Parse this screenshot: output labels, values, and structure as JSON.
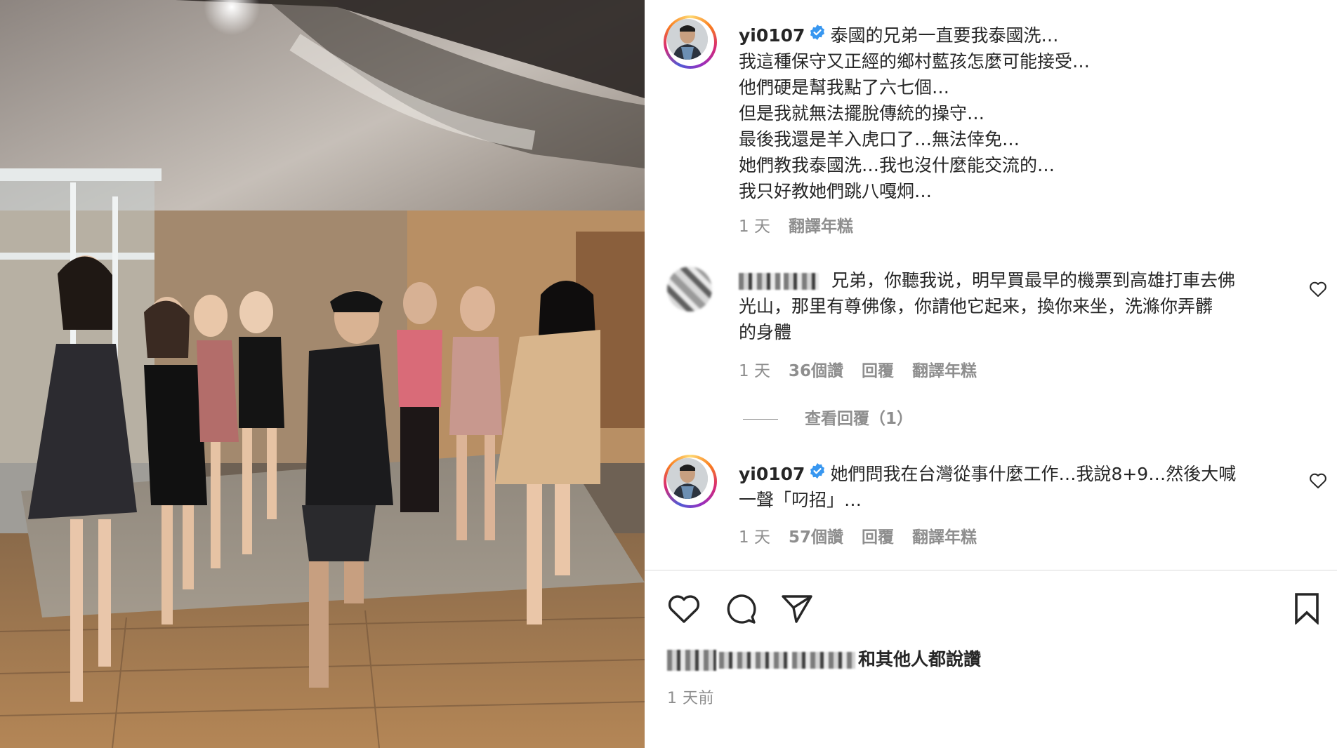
{
  "post": {
    "author": "yi0107",
    "caption_lines": [
      "泰國的兄弟一直要我泰國洗…",
      "我這種保守又正經的鄉村藍孩怎麼可能接受…",
      "他們硬是幫我點了六七個…",
      "但是我就無法擺脫傳統的操守…",
      "最後我還是羊入虎口了…無法倖免…",
      "她們教我泰國洗…我也沒什麼能交流的…",
      "我只好教她們跳八嘎炯…"
    ],
    "time": "1 天",
    "translate": "翻譯年糕"
  },
  "comments": [
    {
      "username": "",
      "text_lines": [
        "兄弟，你聽我说，明早買最早的機票到高雄打車去佛",
        "光山，那里有尊佛像，你請他它起来，換你来坐，洗滌你弄髒",
        "的身體"
      ],
      "time": "1 天",
      "likes": "36個讚",
      "reply": "回覆",
      "translate": "翻譯年糕",
      "view_replies": "查看回覆（1）"
    },
    {
      "username": "yi0107",
      "text_lines": [
        "她們問我在台灣從事什麼工作…我說8+9…然後大喊",
        "一聲「叼招」…"
      ],
      "time": "1 天",
      "likes": "57個讚",
      "reply": "回覆",
      "translate": "翻譯年糕"
    }
  ],
  "liked_by_suffix": "和其他人都說讚",
  "post_time": "1 天前",
  "icons": {
    "like": "heart-icon",
    "comment": "comment-icon",
    "share": "send-icon",
    "save": "bookmark-icon",
    "verified": "verified-badge-icon"
  },
  "colors": {
    "verified": "#3897f0",
    "secondary_text": "#8e8e8e",
    "primary_text": "#262626",
    "divider": "#dbdbdb"
  }
}
